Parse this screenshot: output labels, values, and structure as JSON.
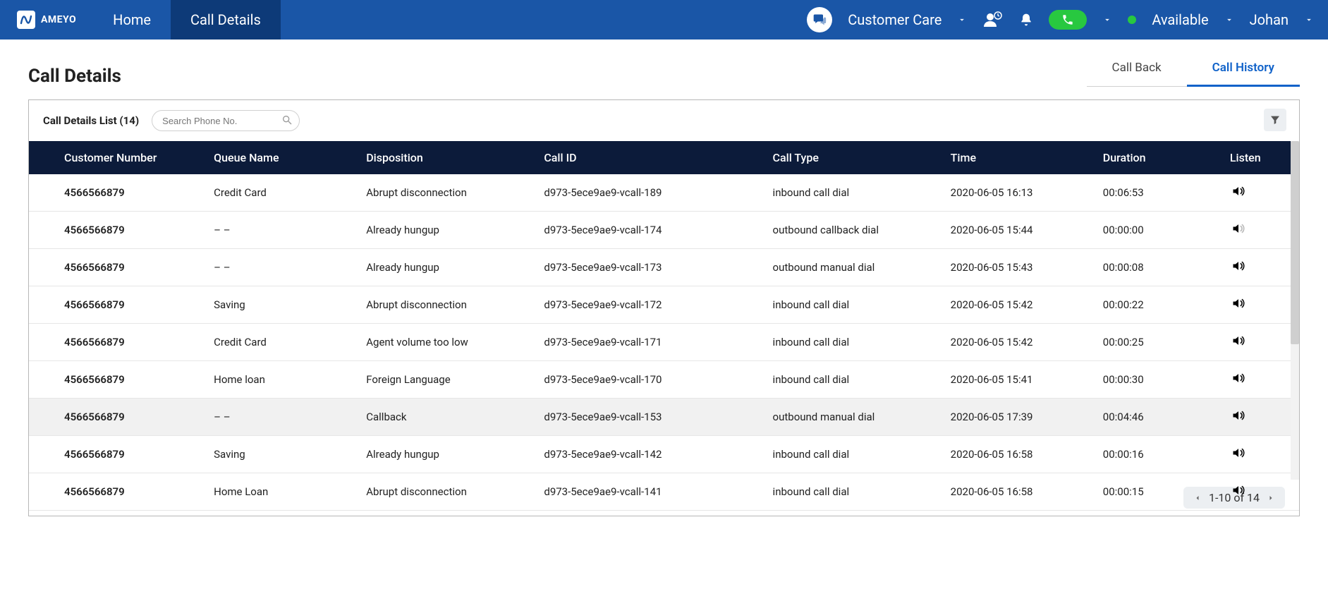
{
  "brand": {
    "name": "AMEYO"
  },
  "header": {
    "tabs": [
      {
        "label": "Home",
        "active": false
      },
      {
        "label": "Call Details",
        "active": true
      }
    ],
    "campaign": "Customer Care",
    "status": "Available",
    "user": "Johan"
  },
  "page": {
    "title": "Call Details",
    "subtabs": [
      {
        "label": "Call Back",
        "active": false
      },
      {
        "label": "Call History",
        "active": true
      }
    ]
  },
  "list": {
    "title": "Call Details List (14)",
    "search_placeholder": "Search Phone No."
  },
  "columns": {
    "customer": "Customer Number",
    "queue": "Queue Name",
    "disposition": "Disposition",
    "callid": "Call ID",
    "calltype": "Call Type",
    "time": "Time",
    "duration": "Duration",
    "listen": "Listen"
  },
  "rows": [
    {
      "customer": "4566566879",
      "queue": "Credit Card",
      "disposition": "Abrupt disconnection",
      "callid": "d973-5ece9ae9-vcall-189",
      "calltype": "inbound call dial",
      "time": "2020-06-05  16:13",
      "duration": "00:06:53",
      "listen": true,
      "highlight": false
    },
    {
      "customer": "4566566879",
      "queue": "– –",
      "disposition": "Already hungup",
      "callid": "d973-5ece9ae9-vcall-174",
      "calltype": "outbound callback dial",
      "time": "2020-06-05  15:44",
      "duration": "00:00:00",
      "listen": false,
      "highlight": false
    },
    {
      "customer": "4566566879",
      "queue": "– –",
      "disposition": "Already hungup",
      "callid": "d973-5ece9ae9-vcall-173",
      "calltype": "outbound manual dial",
      "time": "2020-06-05  15:43",
      "duration": "00:00:08",
      "listen": true,
      "highlight": false
    },
    {
      "customer": "4566566879",
      "queue": "Saving",
      "disposition": "Abrupt disconnection",
      "callid": "d973-5ece9ae9-vcall-172",
      "calltype": "inbound call dial",
      "time": "2020-06-05  15:42",
      "duration": "00:00:22",
      "listen": true,
      "highlight": false
    },
    {
      "customer": "4566566879",
      "queue": "Credit Card",
      "disposition": "Agent volume too low",
      "callid": "d973-5ece9ae9-vcall-171",
      "calltype": "inbound call dial",
      "time": "2020-06-05  15:42",
      "duration": "00:00:25",
      "listen": true,
      "highlight": false
    },
    {
      "customer": "4566566879",
      "queue": "Home loan",
      "disposition": "Foreign Language",
      "callid": "d973-5ece9ae9-vcall-170",
      "calltype": "inbound call dial",
      "time": "2020-06-05  15:41",
      "duration": "00:00:30",
      "listen": true,
      "highlight": false
    },
    {
      "customer": "4566566879",
      "queue": "– –",
      "disposition": "Callback",
      "callid": "d973-5ece9ae9-vcall-153",
      "calltype": "outbound manual dial",
      "time": "2020-06-05  17:39",
      "duration": "00:04:46",
      "listen": true,
      "highlight": true
    },
    {
      "customer": "4566566879",
      "queue": "Saving",
      "disposition": "Already hungup",
      "callid": "d973-5ece9ae9-vcall-142",
      "calltype": "inbound call dial",
      "time": "2020-06-05  16:58",
      "duration": "00:00:16",
      "listen": true,
      "highlight": false
    },
    {
      "customer": "4566566879",
      "queue": "Home Loan",
      "disposition": "Abrupt disconnection",
      "callid": "d973-5ece9ae9-vcall-141",
      "calltype": "inbound call dial",
      "time": "2020-06-05  16:58",
      "duration": "00:00:15",
      "listen": true,
      "highlight": false
    }
  ],
  "pager": {
    "text": "1-10 of 14"
  }
}
